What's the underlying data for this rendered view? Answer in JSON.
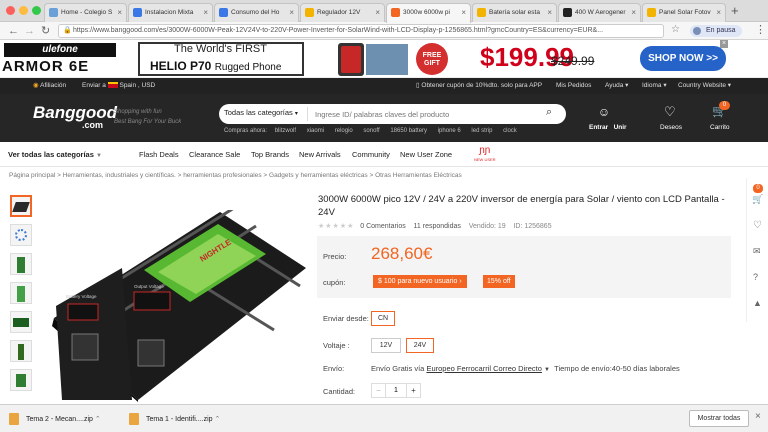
{
  "tabs": [
    {
      "label": "Home - Colegio S",
      "color": "#6aa0d8",
      "active": false
    },
    {
      "label": "Instalacion Mixta",
      "color": "#3b78e7",
      "active": false
    },
    {
      "label": "Consumo del Ho",
      "color": "#3b78e7",
      "active": false
    },
    {
      "label": "Regulador 12V",
      "color": "#f2b400",
      "active": false
    },
    {
      "label": "3000w 6000w pi",
      "color": "#f26522",
      "active": true
    },
    {
      "label": "Batería solar esta",
      "color": "#f2b400",
      "active": false
    },
    {
      "label": "400 W Aerogener",
      "color": "#222222",
      "active": false
    },
    {
      "label": "Panel Solar Fotov",
      "color": "#f2b400",
      "active": false
    }
  ],
  "browser": {
    "url": "https://www.banggood.com/es/3000W-6000W-Peak-12V24V-to-220V-Power-Inverter-for-SolarWind-with-LCD-Display-p-1256865.html?gmcCountry=ES&currency=EUR&...",
    "pause_label": "En pausa"
  },
  "ad": {
    "brand": "ulefone",
    "brand2": "ARMOR 6E",
    "tagline": "The World's FIRST",
    "product": "HELIO P70",
    "product_sub": "Rugged Phone",
    "gift": "FREE GIFT",
    "price": "$199.99",
    "old_price": "$249.99",
    "cta": "SHOP NOW >>"
  },
  "topbar": {
    "affiliate": "Afiliación",
    "ship_to": "Enviar a",
    "country": "Spain , USD",
    "coupon": "Obtener cupón de 10%dto. solo para APP",
    "orders": "Mis Pedidos",
    "help": "Ayuda",
    "language": "Idioma",
    "country_site": "Country Website"
  },
  "header": {
    "logo": "Banggood",
    "logo_sub": ".com",
    "slogan1": "Shopping with fun",
    "slogan2": "Best Bang For Your Buck",
    "categories_select": "Todas las categorías",
    "search_placeholder": "Ingrese ID/ palabras claves del producto",
    "popular_label": "Compras ahora:",
    "popular": [
      "blitzwolf",
      "xiaomi",
      "relogio",
      "sonoff",
      "18650 battery",
      "iphone 6",
      "led strip",
      "clock"
    ],
    "signin": "Entrar",
    "join": "Unir",
    "wishlist": "Deseos",
    "cart": "Carrito",
    "cart_count": "0"
  },
  "catnav": {
    "all": "Ver todas las categorías",
    "items": [
      "Flash Deals",
      "Clearance Sale",
      "Top Brands",
      "New Arrivals",
      "Community",
      "New User Zone"
    ],
    "newuser_badge": "NEW USER"
  },
  "breadcrumb": [
    "Página principal",
    "Herramientas, industriales y científicas.",
    "herramientas profesionales",
    "Gadgets y herramientas eléctricas",
    "Otras Herramientas Eléctricas"
  ],
  "product": {
    "title": "3000W 6000W pico 12V / 24V a 220V inversor de energía para Solar / viento con LCD Pantalla - 24V",
    "comments": "0 Comentarios",
    "answered": "11 respondidas",
    "sold": "Vendido: 19",
    "id": "ID: 1256865",
    "price_label": "Precio:",
    "price": "268,60€",
    "coupon_label": "cupón:",
    "coupon_new_user": "$ 100 para nuevo usuario",
    "coupon_discount": "15% off",
    "ship_from_label": "Enviar desde:",
    "ship_from": "CN",
    "voltage_label": "Voltaje :",
    "voltages": [
      "12V",
      "24V"
    ],
    "selected_voltage": "24V",
    "shipping_label": "Envío:",
    "shipping_text": "Envío Gratis vía",
    "shipping_method": "Europeo Ferrocarril Correo Directo",
    "shipping_time": "Tiempo de envío:40-50 días laborales",
    "quantity_label": "Cantidad:",
    "quantity": "1",
    "device_text1": "Battery Voltage",
    "device_text2": "Output Voltage",
    "device_brand": "NIGHTLE"
  },
  "rightrail": {
    "cart_count": "0"
  },
  "downloads": {
    "items": [
      "Tema 2 - Mecan....zip",
      "Tema 1 - Identifi....zip"
    ],
    "show_all": "Mostrar todas"
  },
  "colors": {
    "accent": "#f26522",
    "dark": "#262626",
    "price": "#f26522"
  }
}
